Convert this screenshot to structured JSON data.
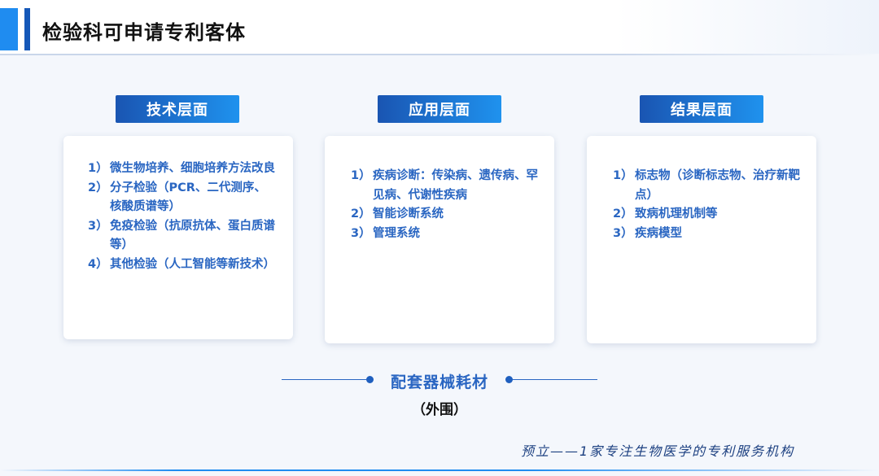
{
  "header": {
    "title": "检验科可申请专利客体"
  },
  "columns": [
    {
      "heading": "技术层面",
      "items": [
        {
          "num": "1）",
          "text": "微生物培养、细胞培养方法改良"
        },
        {
          "num": "2）",
          "text": "分子检验（PCR、二代测序、核酸质谱等）"
        },
        {
          "num": "3）",
          "text": "免疫检验（抗原抗体、蛋白质谱等）"
        },
        {
          "num": "4）",
          "text": "其他检验（人工智能等新技术）"
        }
      ]
    },
    {
      "heading": "应用层面",
      "items": [
        {
          "num": "1）",
          "text": "疾病诊断：传染病、遗传病、罕见病、代谢性疾病"
        },
        {
          "num": "2）",
          "text": "智能诊断系统"
        },
        {
          "num": "3）",
          "text": "管理系统"
        }
      ]
    },
    {
      "heading": "结果层面",
      "items": [
        {
          "num": "1）",
          "text": "标志物（诊断标志物、治疗新靶点）"
        },
        {
          "num": "2）",
          "text": "致病机理机制等"
        },
        {
          "num": "3）",
          "text": "疾病模型"
        }
      ]
    }
  ],
  "supporting": {
    "title": "配套器械耗材",
    "subtitle": "（外围）"
  },
  "footer": {
    "slogan": "预立——1家专注生物医学的专利服务机构"
  }
}
